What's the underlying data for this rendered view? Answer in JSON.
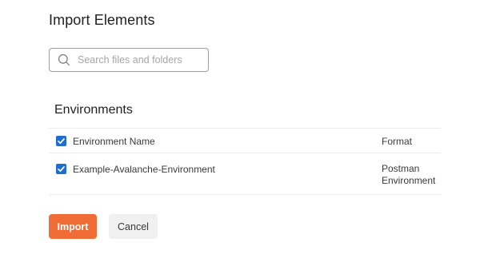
{
  "dialog": {
    "title": "Import Elements"
  },
  "search": {
    "placeholder": "Search files and folders",
    "value": ""
  },
  "environments": {
    "section_title": "Environments",
    "columns": {
      "name": "Environment Name",
      "format": "Format"
    },
    "header_checked": true,
    "rows": [
      {
        "checked": true,
        "name": "Example-Avalanche-Environment",
        "format": "Postman Environment"
      }
    ]
  },
  "actions": {
    "import_label": "Import",
    "cancel_label": "Cancel"
  },
  "colors": {
    "accent": "#ef6c36",
    "checkbox": "#1f6dd1"
  }
}
